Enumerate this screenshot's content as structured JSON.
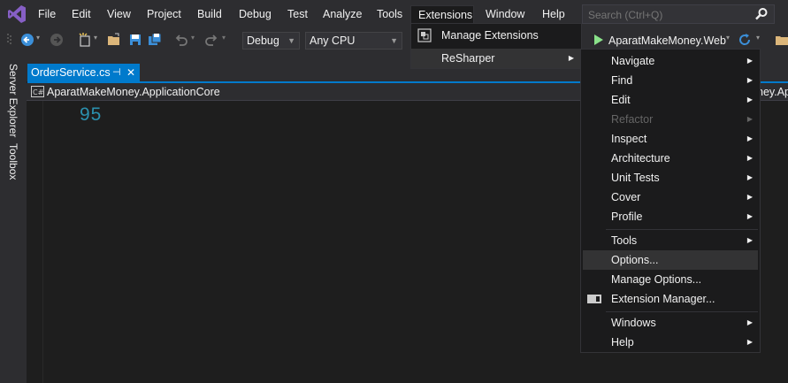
{
  "menubar": {
    "items": [
      "File",
      "Edit",
      "View",
      "Project",
      "Build",
      "Debug",
      "Test",
      "Analyze",
      "Tools",
      "Extensions",
      "Window",
      "Help"
    ],
    "active": "Extensions"
  },
  "search": {
    "placeholder": "Search (Ctrl+Q)"
  },
  "toolbar": {
    "config": "Debug",
    "platform": "Any CPU",
    "startup_project": "AparatMakeMoney.Web"
  },
  "rail": {
    "server_explorer": "Server Explorer",
    "toolbox": "Toolbox"
  },
  "document": {
    "tab_title": "OrderService.cs",
    "pin_glyph": "⊣",
    "close_glyph": "✕",
    "nav_project": "AparatMakeMoney.ApplicationCore",
    "nav_right_fragment": "ney.Apl",
    "line_number": "95"
  },
  "extensions_menu": {
    "items": [
      {
        "label": "Manage Extensions",
        "icon": "manage-extensions-icon"
      },
      {
        "label": "ReSharper",
        "submenu": true
      }
    ]
  },
  "resharper_menu": {
    "items": [
      {
        "label": "Navigate",
        "submenu": true
      },
      {
        "label": "Find",
        "submenu": true
      },
      {
        "label": "Edit",
        "submenu": true
      },
      {
        "label": "Refactor",
        "submenu": true,
        "disabled": true
      },
      {
        "label": "Inspect",
        "submenu": true
      },
      {
        "label": "Architecture",
        "submenu": true
      },
      {
        "label": "Unit Tests",
        "submenu": true
      },
      {
        "label": "Cover",
        "submenu": true
      },
      {
        "label": "Profile",
        "submenu": true
      },
      {
        "label": "Tools",
        "submenu": true
      },
      {
        "label": "Options...",
        "highlighted": true
      },
      {
        "label": "Manage Options..."
      },
      {
        "label": "Extension Manager...",
        "icon": "extension-manager-icon"
      },
      {
        "label": "Windows",
        "submenu": true
      },
      {
        "label": "Help",
        "submenu": true
      }
    ]
  },
  "colors": {
    "accent": "#007acc",
    "menubar_bg": "#2d2d30",
    "editor_bg": "#1e1e1e",
    "menu_bg": "#1b1b1c",
    "run_green": "#8ae28a",
    "line_number": "#2b91af"
  }
}
